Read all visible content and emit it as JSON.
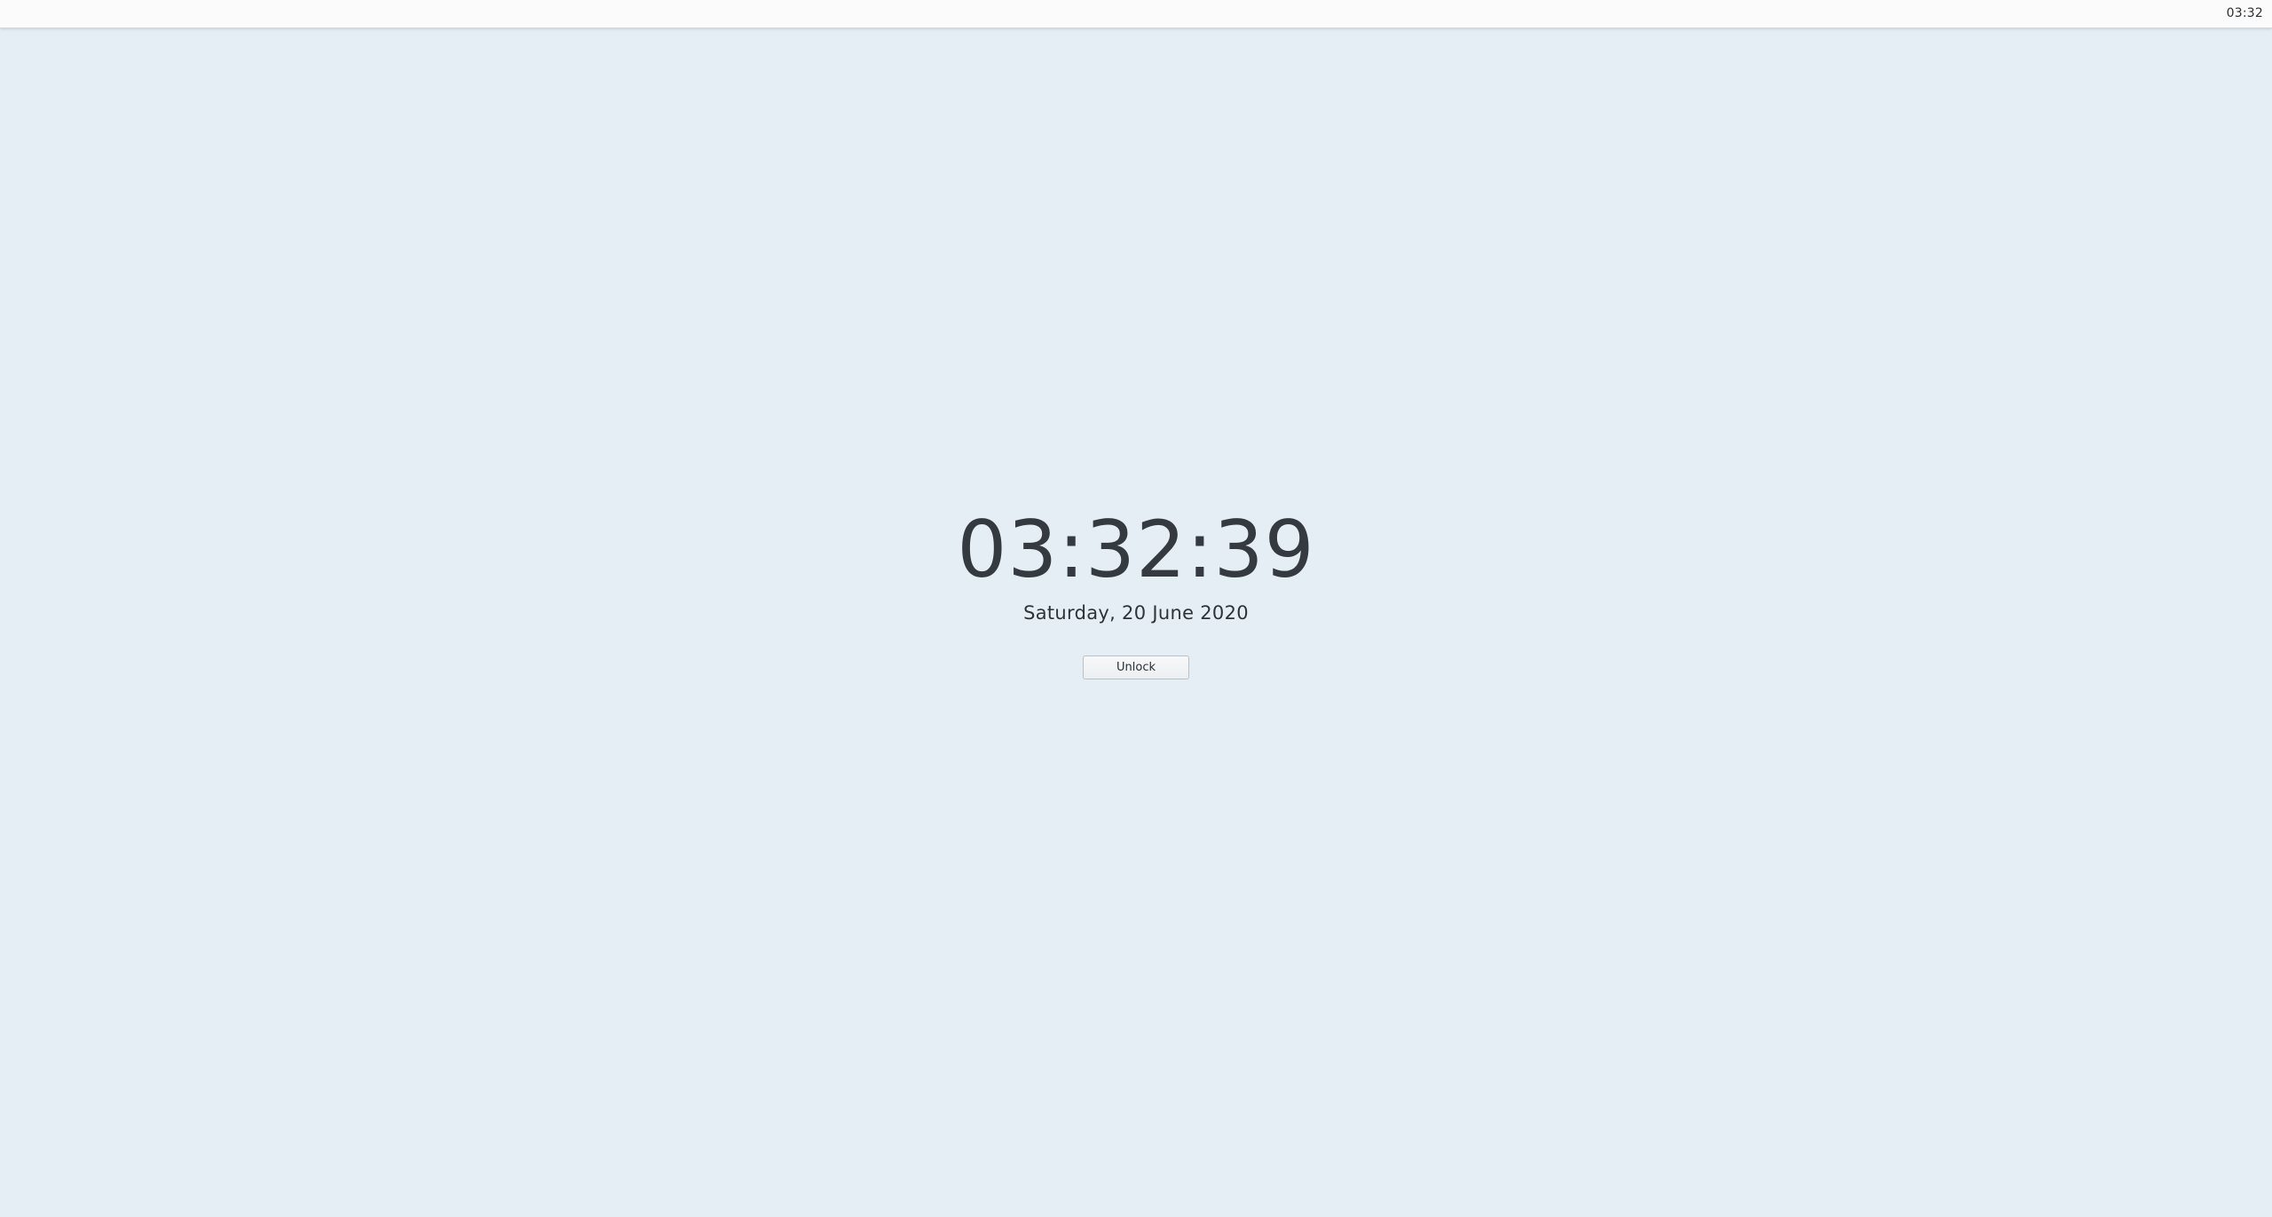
{
  "top_bar": {
    "clock": "03:32"
  },
  "lock_screen": {
    "time": "03:32:39",
    "date": "Saturday, 20 June 2020",
    "unlock_label": "Unlock"
  },
  "colors": {
    "background": "#e4eef4",
    "top_bar": "#fbfbfb",
    "text": "#343a40"
  }
}
